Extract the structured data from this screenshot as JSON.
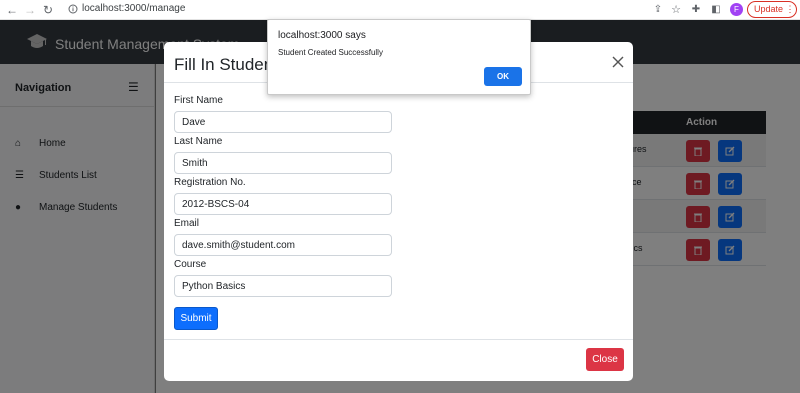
{
  "browser": {
    "url": "localhost:3000/manage",
    "update_label": "Update",
    "profile_initial": "F"
  },
  "app": {
    "title": "Student Management System",
    "sidebar": {
      "title": "Navigation",
      "items": [
        {
          "label": "Home",
          "icon": "home-icon"
        },
        {
          "label": "Students List",
          "icon": "list-icon"
        },
        {
          "label": "Manage Students",
          "icon": "user-icon"
        }
      ]
    },
    "table": {
      "action_header": "Action",
      "rows": [
        {
          "course": "ctures"
        },
        {
          "course": "ence"
        },
        {
          "course": ""
        },
        {
          "course": "asics"
        }
      ]
    }
  },
  "modal": {
    "title": "Fill In Student D",
    "fields": [
      {
        "label": "First Name",
        "value": "Dave"
      },
      {
        "label": "Last Name",
        "value": "Smith"
      },
      {
        "label": "Registration No.",
        "value": "2012-BSCS-04"
      },
      {
        "label": "Email",
        "value": "dave.smith@student.com"
      },
      {
        "label": "Course",
        "value": "Python Basics"
      }
    ],
    "submit_label": "Submit",
    "close_label": "Close"
  },
  "alert": {
    "title": "localhost:3000 says",
    "message": "Student Created Successfully",
    "ok_label": "OK"
  },
  "colors": {
    "primary": "#0d6efd",
    "danger": "#dc3545",
    "dark": "#212529",
    "header": "#343a40"
  }
}
